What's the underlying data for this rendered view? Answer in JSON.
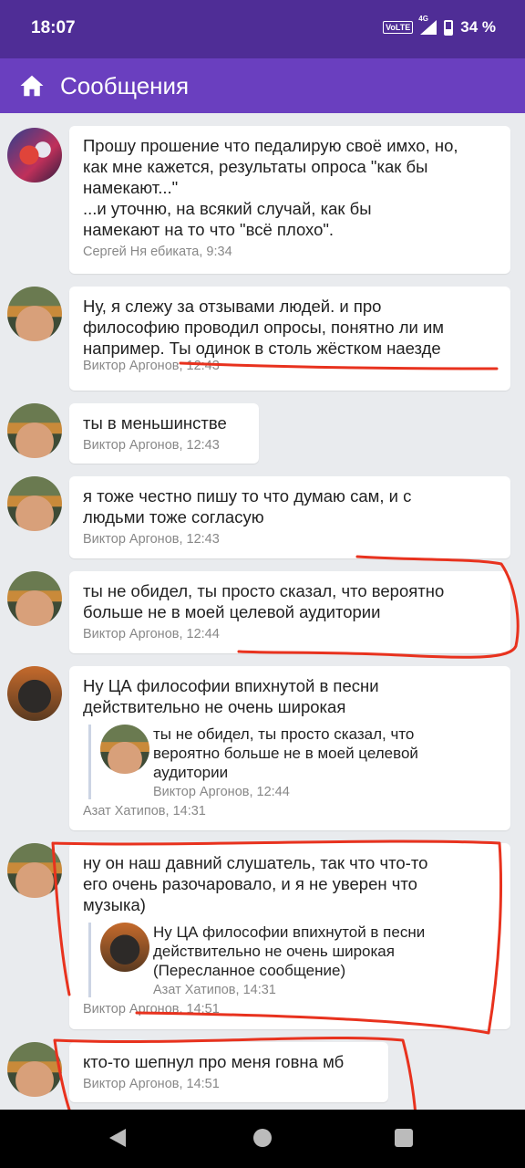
{
  "status": {
    "time": "18:07",
    "volte": "VoLTE",
    "network": "4G",
    "battery": "34 %"
  },
  "appbar": {
    "title": "Сообщения",
    "home_icon": "home-icon"
  },
  "messages": [
    {
      "author": "Сергей Ня ебиката",
      "time": "9:34",
      "meta": "Сергей Ня ебиката, 9:34",
      "text": "Прошу прошение что педалирую своё имхо, но,\nкак мне кажется, результаты опроса \"как бы\nнамекают...\"\n...и уточню, на всякий случай, как бы\nнамекают на то что \"всё плохо\"."
    },
    {
      "author": "Виктор Аргонов",
      "time": "12:43",
      "meta": "Виктор Аргонов, 12:43",
      "text": "Ну, я слежу за отзывами людей. и про\nфилософию проводил опросы, понятно ли им\nнапример. Ты одинок в столь жёстком наезде"
    },
    {
      "author": "Виктор Аргонов",
      "time": "12:43",
      "meta": "Виктор Аргонов, 12:43",
      "text": "ты в меньшинстве"
    },
    {
      "author": "Виктор Аргонов",
      "time": "12:43",
      "meta": "Виктор Аргонов, 12:43",
      "text": "я тоже честно пишу то что думаю сам, и с\nлюдьми тоже согласую"
    },
    {
      "author": "Виктор Аргонов",
      "time": "12:44",
      "meta": "Виктор Аргонов, 12:44",
      "text": "ты не обидел, ты просто сказал, что вероятно\nбольше не в моей целевой аудитории"
    },
    {
      "author": "Азат Хатипов",
      "time": "14:31",
      "meta": "Азат Хатипов, 14:31",
      "text": "Ну ЦА философии впихнутой в песни\nдействительно не очень широкая",
      "forward": {
        "text": "ты не обидел, ты просто сказал, что\nвероятно больше не в моей целевой\nаудитории",
        "meta": "Виктор Аргонов, 12:44"
      }
    },
    {
      "author": "Виктор Аргонов",
      "time": "14:51",
      "meta": "Виктор Аргонов, 14:51",
      "text": "ну он наш давний слушатель, так что что-то\nего очень разочаровало, и я не уверен что\nмузыка)",
      "forward": {
        "text": "Ну ЦА философии впихнутой в песни\nдействительно не очень широкая\n(Пересланное сообщение)",
        "meta": "Азат Хатипов, 14:31"
      }
    },
    {
      "author": "Виктор Аргонов",
      "time": "14:51",
      "meta": "Виктор Аргонов, 14:51",
      "text": "кто-то шепнул про меня говна мб"
    }
  ],
  "annotation_color": "#e8321e",
  "nav": {
    "back_icon": "back-icon",
    "home_icon": "home-circle-icon",
    "recents_icon": "recents-icon"
  }
}
